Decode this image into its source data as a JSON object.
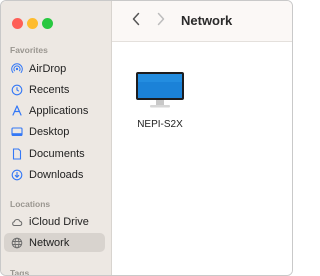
{
  "window": {
    "title": "Network"
  },
  "sidebar": {
    "sections": [
      {
        "header": "Favorites",
        "items": [
          {
            "label": "AirDrop",
            "icon": "airdrop-icon"
          },
          {
            "label": "Recents",
            "icon": "clock-icon"
          },
          {
            "label": "Applications",
            "icon": "applications-icon"
          },
          {
            "label": "Desktop",
            "icon": "desktop-icon"
          },
          {
            "label": "Documents",
            "icon": "document-icon"
          },
          {
            "label": "Downloads",
            "icon": "download-icon"
          }
        ]
      },
      {
        "header": "Locations",
        "items": [
          {
            "label": "iCloud Drive",
            "icon": "cloud-icon"
          },
          {
            "label": "Network",
            "icon": "globe-icon",
            "selected": true
          }
        ]
      },
      {
        "header": "Tags",
        "items": []
      }
    ]
  },
  "content": {
    "items": [
      {
        "label": "NEPI-S2X",
        "icon": "monitor-icon"
      }
    ]
  },
  "colors": {
    "accent": "#3478f6",
    "sidebar_bg": "#ede8e3",
    "selected_bg": "#d8d3ce"
  }
}
